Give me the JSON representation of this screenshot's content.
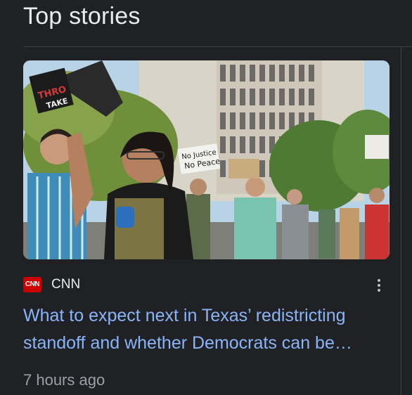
{
  "section": {
    "title": "Top stories"
  },
  "story": {
    "source": "CNN",
    "source_logo_text": "CNN",
    "headline": "What to expect next in Texas’ redistricting standoff and whether Democrats can be…",
    "time": "7 hours ago",
    "sign_texts": [
      "No Justice No Peace"
    ],
    "image_icon": "protest-photo"
  },
  "colors": {
    "background": "#202124",
    "headline": "#8ab4f8",
    "brand": "#cc0000"
  }
}
